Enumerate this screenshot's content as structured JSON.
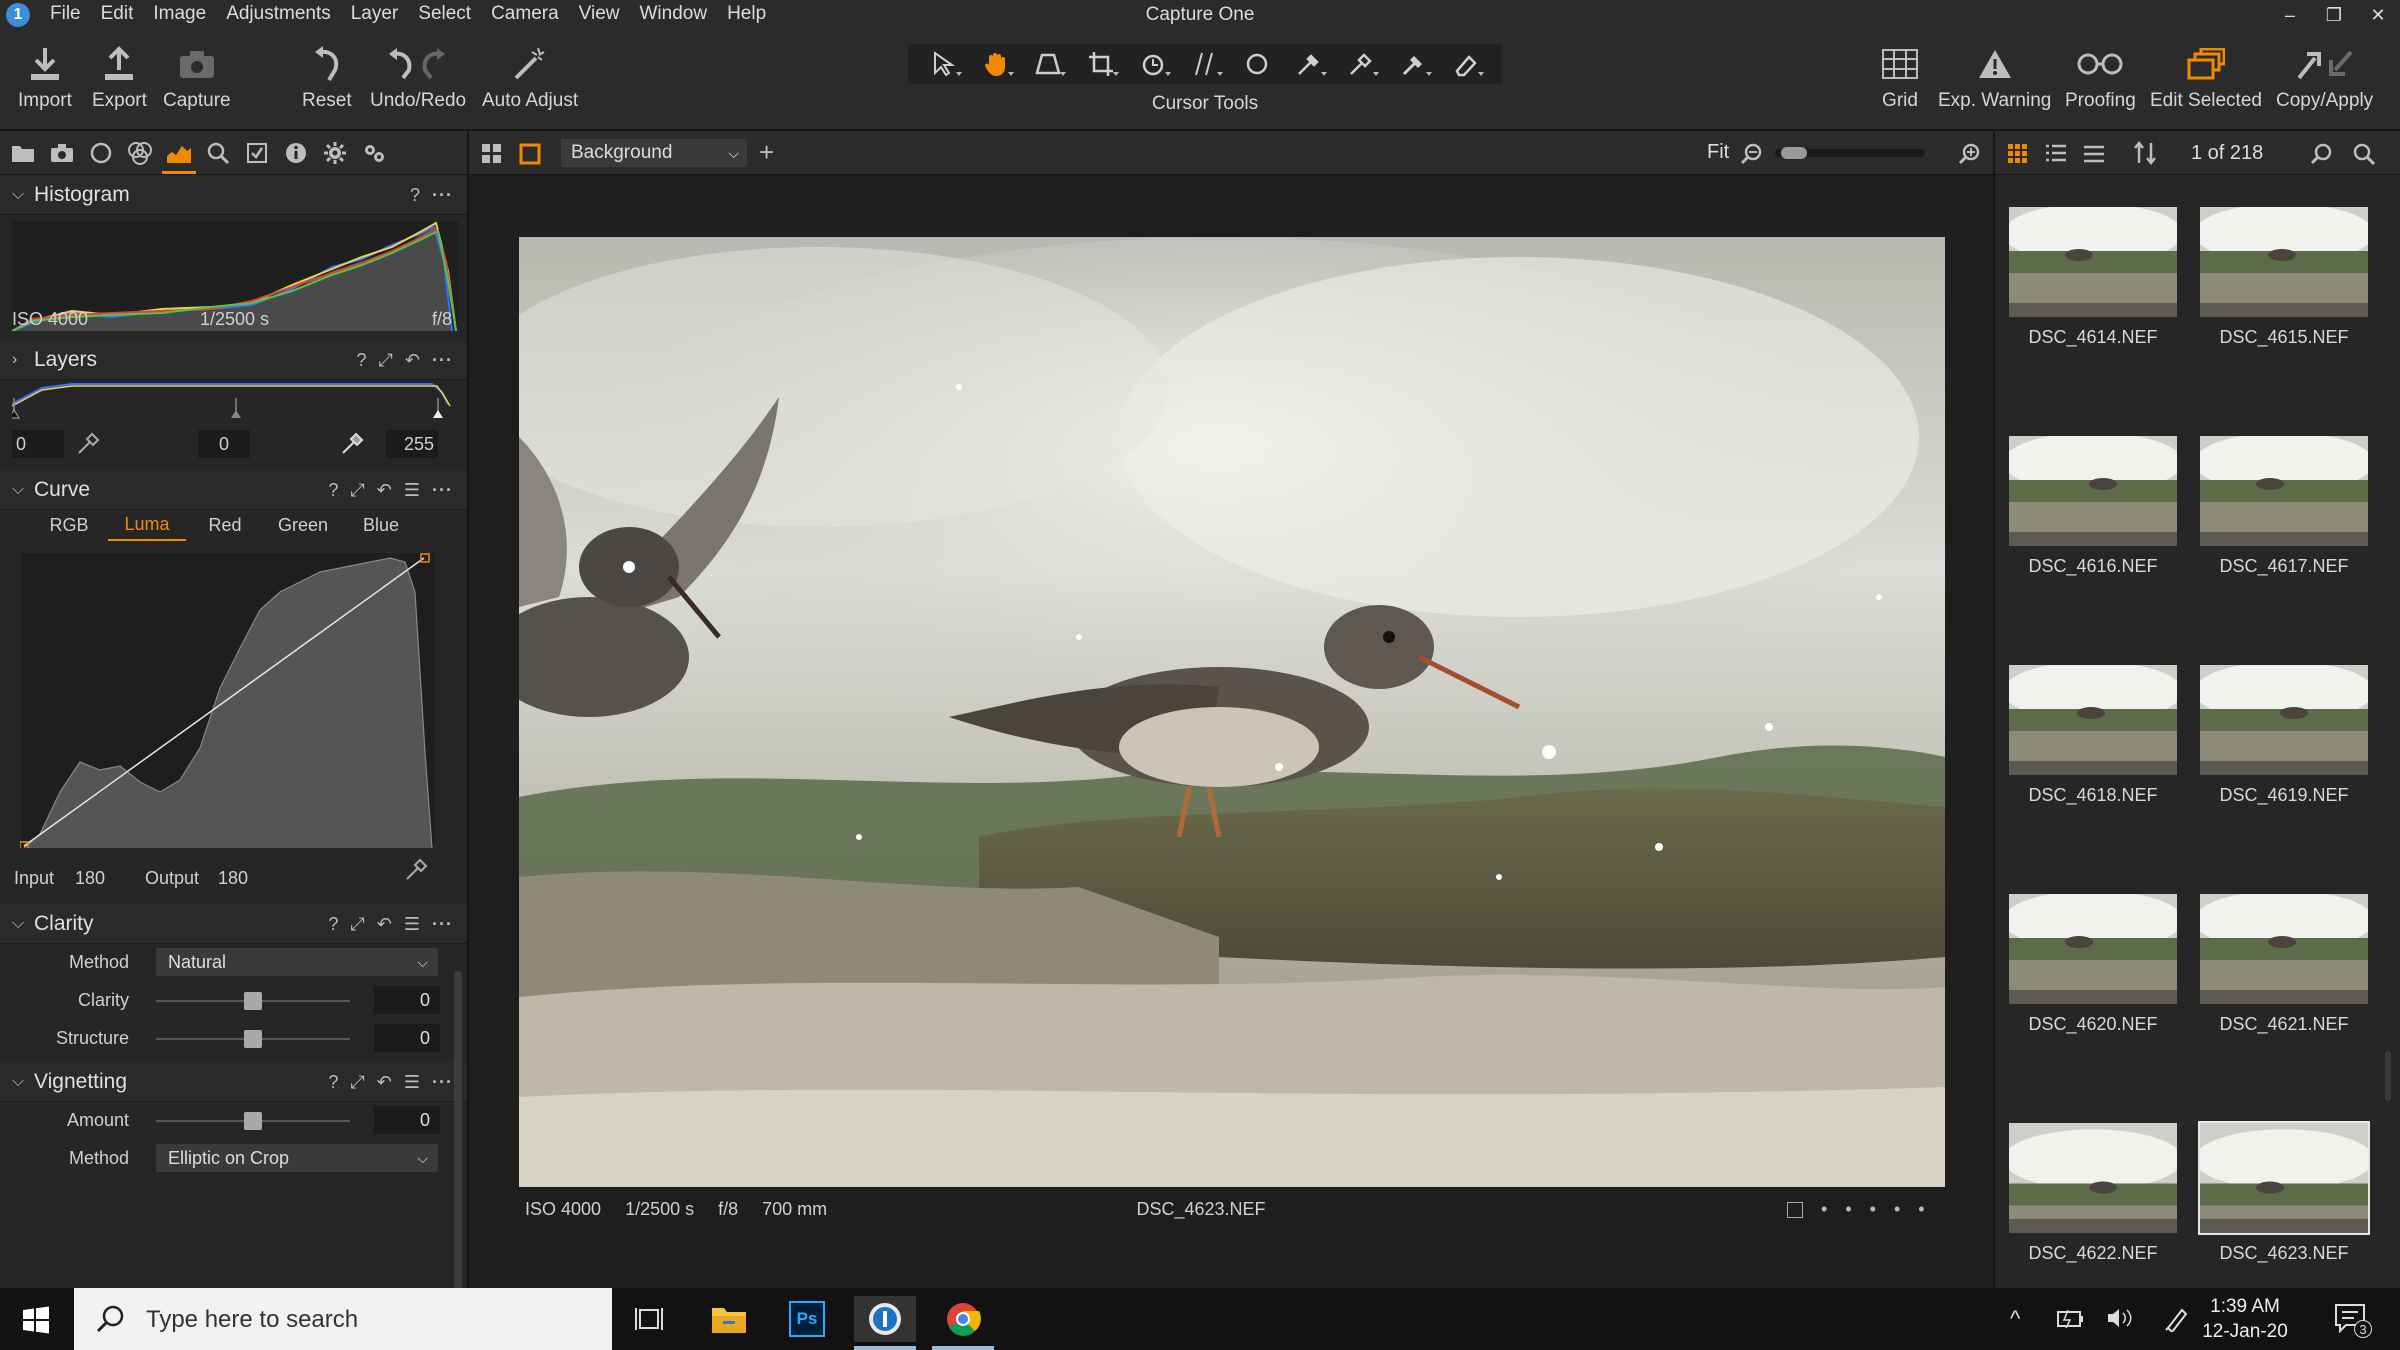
{
  "app": {
    "title": "Capture One",
    "logo_glyph": "1"
  },
  "menu": [
    "File",
    "Edit",
    "Image",
    "Adjustments",
    "Layer",
    "Select",
    "Camera",
    "View",
    "Window",
    "Help"
  ],
  "window_controls": [
    "–",
    "❐",
    "✕"
  ],
  "toolbar": {
    "import": "Import",
    "export": "Export",
    "capture": "Capture",
    "reset": "Reset",
    "undo_redo": "Undo/Redo",
    "auto_adjust": "Auto Adjust",
    "cursor_tools": "Cursor Tools",
    "grid": "Grid",
    "exp_warning": "Exp. Warning",
    "proofing": "Proofing",
    "edit_selected": "Edit Selected",
    "copy_apply": "Copy/Apply"
  },
  "colors": {
    "accent": "#f08a00",
    "panel": "#262626",
    "bar": "#2b2b2b"
  },
  "histogram": {
    "title": "Histogram",
    "help": "?",
    "iso": "ISO 4000",
    "shutter": "1/2500 s",
    "aperture": "f/8"
  },
  "layers": {
    "title": "Layers",
    "help": "?",
    "black_value": "0",
    "mid_value": "0",
    "white_value": "255"
  },
  "curve": {
    "title": "Curve",
    "help": "?",
    "tabs": [
      "RGB",
      "Luma",
      "Red",
      "Green",
      "Blue"
    ],
    "active_tab": "Luma",
    "input_label": "Input",
    "input_value": "180",
    "output_label": "Output",
    "output_value": "180"
  },
  "clarity": {
    "title": "Clarity",
    "help": "?",
    "method_label": "Method",
    "method_value": "Natural",
    "clarity_label": "Clarity",
    "clarity_value": "0",
    "clarity_level": 0.5,
    "structure_label": "Structure",
    "structure_value": "0",
    "structure_level": 0.5
  },
  "vignetting": {
    "title": "Vignetting",
    "help": "?",
    "amount_label": "Amount",
    "amount_value": "0",
    "amount_level": 0.5,
    "method_label": "Method",
    "method_value": "Elliptic on Crop"
  },
  "viewer": {
    "layer_select": "Background",
    "zoom_label": "Fit",
    "zoom_level": 0.05,
    "iso": "ISO 4000",
    "shutter": "1/2500 s",
    "aperture": "f/8",
    "focal": "700 mm",
    "filename": "DSC_4623.NEF"
  },
  "browser": {
    "counter": "1 of 218",
    "thumbnails": [
      {
        "name": "DSC_4614.NEF"
      },
      {
        "name": "DSC_4615.NEF"
      },
      {
        "name": "DSC_4616.NEF"
      },
      {
        "name": "DSC_4617.NEF"
      },
      {
        "name": "DSC_4618.NEF"
      },
      {
        "name": "DSC_4619.NEF"
      },
      {
        "name": "DSC_4620.NEF"
      },
      {
        "name": "DSC_4621.NEF"
      },
      {
        "name": "DSC_4622.NEF"
      },
      {
        "name": "DSC_4623.NEF",
        "selected": true
      }
    ]
  },
  "taskbar": {
    "search_placeholder": "Type here to search",
    "time": "1:39 AM",
    "date": "12-Jan-20",
    "notification_count": "3",
    "ps_label": "Ps"
  }
}
